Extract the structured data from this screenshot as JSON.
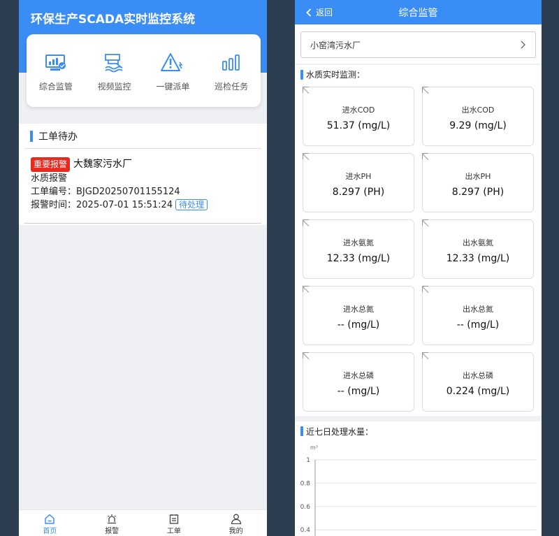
{
  "left": {
    "title": "环保生产SCADA实时监控系统",
    "menu": [
      {
        "label": "综合监管",
        "icon": "monitor-icon"
      },
      {
        "label": "视频监控",
        "icon": "camera-icon"
      },
      {
        "label": "一键派单",
        "icon": "alert-icon"
      },
      {
        "label": "巡检任务",
        "icon": "bar-chart-icon"
      }
    ],
    "section_title": "工单待办",
    "work_order": {
      "badge": "重要报警",
      "plant": "大魏家污水厂",
      "type": "水质报警",
      "number_label": "工单编号：",
      "number": "BJGD20250701155124",
      "time_label": "报警时间：",
      "time": "2025-07-01 15:51:24",
      "status": "待处理"
    },
    "tabs": [
      {
        "label": "首页",
        "icon": "home-icon",
        "active": true
      },
      {
        "label": "报警",
        "icon": "alarm-icon",
        "active": false
      },
      {
        "label": "工单",
        "icon": "clipboard-icon",
        "active": false
      },
      {
        "label": "我的",
        "icon": "user-icon",
        "active": false
      }
    ]
  },
  "right": {
    "back_label": "返回",
    "nav_title": "综合监管",
    "plant_select": "小窑湾污水厂",
    "wq_title": "水质实时监测：",
    "tiles": [
      {
        "label": "进水COD",
        "value": "51.37 (mg/L)"
      },
      {
        "label": "出水COD",
        "value": "9.29 (mg/L)"
      },
      {
        "label": "进水PH",
        "value": "8.297 (PH)"
      },
      {
        "label": "出水PH",
        "value": "8.297 (PH)"
      },
      {
        "label": "进水氨氮",
        "value": "12.33 (mg/L)"
      },
      {
        "label": "出水氨氮",
        "value": "12.33 (mg/L)"
      },
      {
        "label": "进水总氮",
        "value": "-- (mg/L)"
      },
      {
        "label": "出水总氮",
        "value": "-- (mg/L)"
      },
      {
        "label": "进水总磷",
        "value": "-- (mg/L)"
      },
      {
        "label": "出水总磷",
        "value": "0.224 (mg/L)"
      }
    ],
    "chart_title": "近七日处理水量："
  },
  "chart_data": {
    "type": "line",
    "title": "近七日处理水量：",
    "ylabel": "m³",
    "ylim": [
      0,
      1
    ],
    "yticks": [
      "1",
      "0.8",
      "0.6",
      "0.4"
    ],
    "grid": true,
    "series": []
  },
  "colors": {
    "primary": "#3a8df5",
    "alert_red": "#e8291d",
    "background": "#2c3e50"
  }
}
